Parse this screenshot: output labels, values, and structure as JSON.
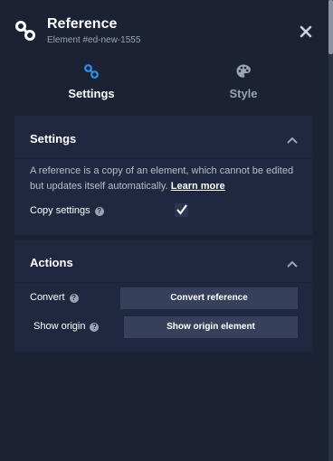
{
  "header": {
    "title": "Reference",
    "subtitle": "Element #ed-new-1555"
  },
  "tabs": [
    {
      "label": "Settings",
      "active": true,
      "icon": "link-icon"
    },
    {
      "label": "Style",
      "active": false,
      "icon": "palette-icon"
    }
  ],
  "settings_section": {
    "title": "Settings",
    "description": "A reference is a copy of an element, which cannot be edited but updates itself automatically.",
    "learn_more": "Learn more",
    "copy_settings_label": "Copy settings",
    "copy_settings_checked": true
  },
  "actions_section": {
    "title": "Actions",
    "convert_label": "Convert",
    "convert_button": "Convert reference",
    "show_origin_label": "Show origin",
    "show_origin_button": "Show origin element"
  },
  "colors": {
    "background": "#1b2233",
    "section": "#202840",
    "button": "#36405a",
    "accent": "#2f8fe6"
  }
}
